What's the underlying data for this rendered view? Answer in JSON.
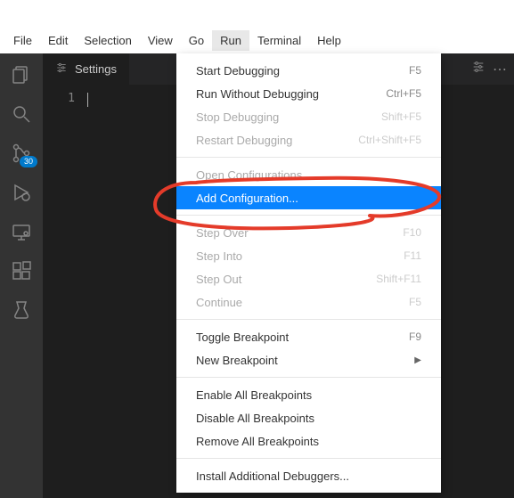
{
  "menubar": [
    "File",
    "Edit",
    "Selection",
    "View",
    "Go",
    "Run",
    "Terminal",
    "Help"
  ],
  "menubar_active_index": 5,
  "tab": {
    "title": "Settings"
  },
  "gutter": {
    "line1": "1"
  },
  "activity": {
    "badge": "30"
  },
  "dropdown": {
    "groups": [
      [
        {
          "label": "Start Debugging",
          "shortcut": "F5",
          "enabled": true
        },
        {
          "label": "Run Without Debugging",
          "shortcut": "Ctrl+F5",
          "enabled": true
        },
        {
          "label": "Stop Debugging",
          "shortcut": "Shift+F5",
          "enabled": false
        },
        {
          "label": "Restart Debugging",
          "shortcut": "Ctrl+Shift+F5",
          "enabled": false
        }
      ],
      [
        {
          "label": "Open Configurations",
          "shortcut": "",
          "enabled": false
        },
        {
          "label": "Add Configuration...",
          "shortcut": "",
          "enabled": true,
          "highlight": true
        }
      ],
      [
        {
          "label": "Step Over",
          "shortcut": "F10",
          "enabled": false
        },
        {
          "label": "Step Into",
          "shortcut": "F11",
          "enabled": false
        },
        {
          "label": "Step Out",
          "shortcut": "Shift+F11",
          "enabled": false
        },
        {
          "label": "Continue",
          "shortcut": "F5",
          "enabled": false
        }
      ],
      [
        {
          "label": "Toggle Breakpoint",
          "shortcut": "F9",
          "enabled": true
        },
        {
          "label": "New Breakpoint",
          "shortcut": "",
          "enabled": true,
          "submenu": true
        }
      ],
      [
        {
          "label": "Enable All Breakpoints",
          "shortcut": "",
          "enabled": true
        },
        {
          "label": "Disable All Breakpoints",
          "shortcut": "",
          "enabled": true
        },
        {
          "label": "Remove All Breakpoints",
          "shortcut": "",
          "enabled": true
        }
      ],
      [
        {
          "label": "Install Additional Debuggers...",
          "shortcut": "",
          "enabled": true
        }
      ]
    ]
  }
}
